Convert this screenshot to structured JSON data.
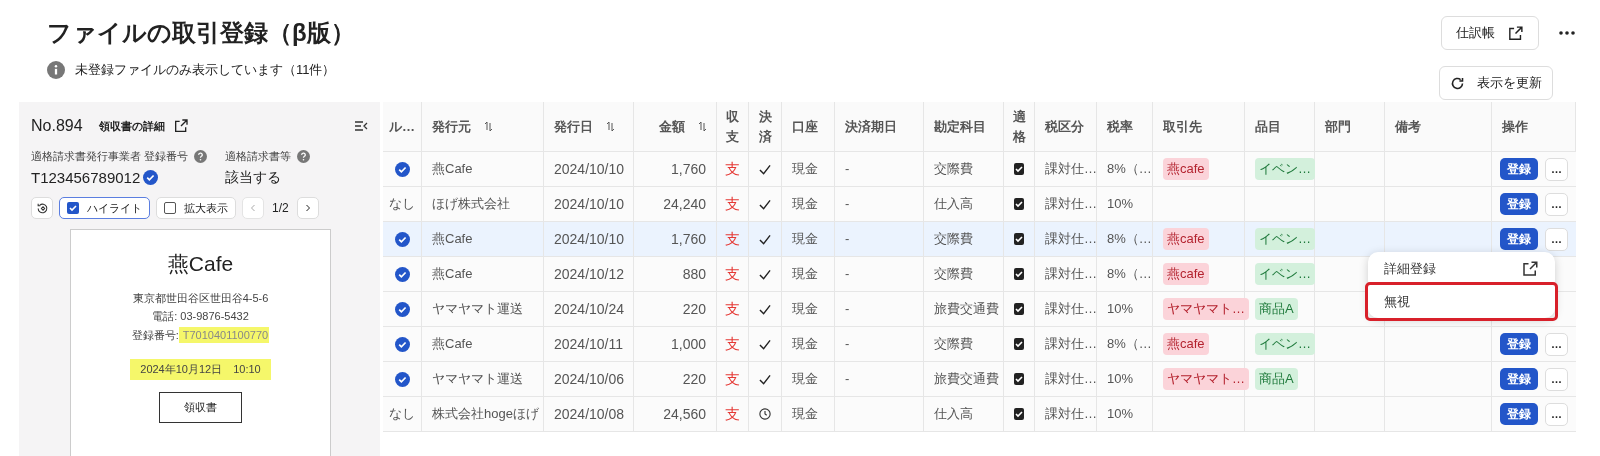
{
  "title": "ファイルの取引登録（β版）",
  "info": "未登録ファイルのみ表示しています（11件）",
  "header_buttons": {
    "journal": "仕訳帳",
    "refresh": "表示を更新"
  },
  "detail": {
    "number": "No.894",
    "link": "領収書の詳細",
    "reg_label": "適格請求書発行事業者 登録番号",
    "reg_value": "T123456789012",
    "reg_verified": true,
    "invoice_label": "適格請求書等",
    "invoice_value": "該当する",
    "highlight": {
      "label": "ハイライト",
      "checked": true
    },
    "zoom": {
      "label": "拡大表示",
      "checked": false
    },
    "page": "1/2",
    "receipt": {
      "shop": "燕Cafe",
      "address": "東京都世田谷区世田谷4-5-6",
      "phone": "電話: 03-9876-5432",
      "reg_prefix": "登録番号:",
      "reg_number": " T7010401100770",
      "datetime": "2024年10月12日　10:10",
      "stamp": "領収書"
    }
  },
  "table": {
    "columns": [
      {
        "label": "ル…",
        "sortable": false
      },
      {
        "label": "発行元",
        "sortable": true
      },
      {
        "label": "発行日",
        "sortable": true
      },
      {
        "label": "金額",
        "sortable": true
      },
      {
        "label": "収支",
        "sortable": false
      },
      {
        "label": "決済",
        "sortable": false
      },
      {
        "label": "口座",
        "sortable": false
      },
      {
        "label": "決済期日",
        "sortable": false
      },
      {
        "label": "勘定科目",
        "sortable": false
      },
      {
        "label": "適格",
        "sortable": false
      },
      {
        "label": "税区分",
        "sortable": false
      },
      {
        "label": "税率",
        "sortable": false
      },
      {
        "label": "取引先",
        "sortable": false
      },
      {
        "label": "品目",
        "sortable": false
      },
      {
        "label": "部門",
        "sortable": false
      },
      {
        "label": "備考",
        "sortable": false
      },
      {
        "label": "操作",
        "sortable": false
      }
    ],
    "rows": [
      {
        "selected": false,
        "rule": {
          "kind": "check"
        },
        "issuer": "燕Cafe",
        "date": "2024/10/10",
        "amount": "1,760",
        "flow": "支",
        "settle": {
          "kind": "check"
        },
        "account": "現金",
        "due": "-",
        "subject": "交際費",
        "qualified": true,
        "tax_class": "課対仕…",
        "tax_rate": "8%（…",
        "partner": "燕cafe",
        "item": "イベン…",
        "register": "登録",
        "more": "…",
        "actions": true
      },
      {
        "selected": false,
        "rule": {
          "kind": "text",
          "text": "なし"
        },
        "issuer": "ほげ株式会社",
        "date": "2024/10/10",
        "amount": "24,240",
        "flow": "支",
        "settle": {
          "kind": "check"
        },
        "account": "現金",
        "due": "-",
        "subject": "仕入高",
        "qualified": true,
        "tax_class": "課対仕…",
        "tax_rate": "10%",
        "register": "登録",
        "more": "…",
        "actions": true
      },
      {
        "selected": true,
        "rule": {
          "kind": "check"
        },
        "issuer": "燕Cafe",
        "date": "2024/10/10",
        "amount": "1,760",
        "flow": "支",
        "settle": {
          "kind": "check"
        },
        "account": "現金",
        "due": "-",
        "subject": "交際費",
        "qualified": true,
        "tax_class": "課対仕…",
        "tax_rate": "8%（…",
        "partner": "燕cafe",
        "item": "イベン…",
        "register": "登録",
        "more": "…",
        "actions": true
      },
      {
        "selected": false,
        "rule": {
          "kind": "check"
        },
        "issuer": "燕Cafe",
        "date": "2024/10/12",
        "amount": "880",
        "flow": "支",
        "settle": {
          "kind": "check"
        },
        "account": "現金",
        "due": "-",
        "subject": "交際費",
        "qualified": true,
        "tax_class": "課対仕…",
        "tax_rate": "8%（…",
        "partner": "燕cafe",
        "item": "イベン…",
        "actions": false
      },
      {
        "selected": false,
        "rule": {
          "kind": "check"
        },
        "issuer": "ヤマヤマト運送",
        "date": "2024/10/24",
        "amount": "220",
        "flow": "支",
        "settle": {
          "kind": "check"
        },
        "account": "現金",
        "due": "-",
        "subject": "旅費交通費",
        "qualified": true,
        "tax_class": "課対仕…",
        "tax_rate": "10%",
        "partner": "ヤマヤマト…",
        "item": "商品A",
        "actions": false
      },
      {
        "selected": false,
        "rule": {
          "kind": "check"
        },
        "issuer": "燕Cafe",
        "date": "2024/10/11",
        "amount": "1,000",
        "flow": "支",
        "settle": {
          "kind": "check"
        },
        "account": "現金",
        "due": "-",
        "subject": "交際費",
        "qualified": true,
        "tax_class": "課対仕…",
        "tax_rate": "8%（…",
        "partner": "燕cafe",
        "item": "イベン…",
        "register": "登録",
        "more": "…",
        "actions": true
      },
      {
        "selected": false,
        "rule": {
          "kind": "check"
        },
        "issuer": "ヤマヤマト運送",
        "date": "2024/10/06",
        "amount": "220",
        "flow": "支",
        "settle": {
          "kind": "check"
        },
        "account": "現金",
        "due": "-",
        "subject": "旅費交通費",
        "qualified": true,
        "tax_class": "課対仕…",
        "tax_rate": "10%",
        "partner": "ヤマヤマト…",
        "item": "商品A",
        "register": "登録",
        "more": "…",
        "actions": true
      },
      {
        "selected": false,
        "rule": {
          "kind": "text",
          "text": "なし"
        },
        "issuer": "株式会社hogeほげ",
        "date": "2024/10/08",
        "amount": "24,560",
        "flow": "支",
        "settle": {
          "kind": "clock"
        },
        "account": "現金",
        "subject": "仕入高",
        "qualified": true,
        "tax_class": "課対仕…",
        "tax_rate": "10%",
        "register": "登録",
        "more": "…",
        "actions": true
      }
    ]
  },
  "menu": {
    "items": [
      {
        "label": "詳細登録",
        "external": true,
        "outlined": false
      },
      {
        "label": "無視",
        "external": false,
        "outlined": true
      }
    ]
  }
}
